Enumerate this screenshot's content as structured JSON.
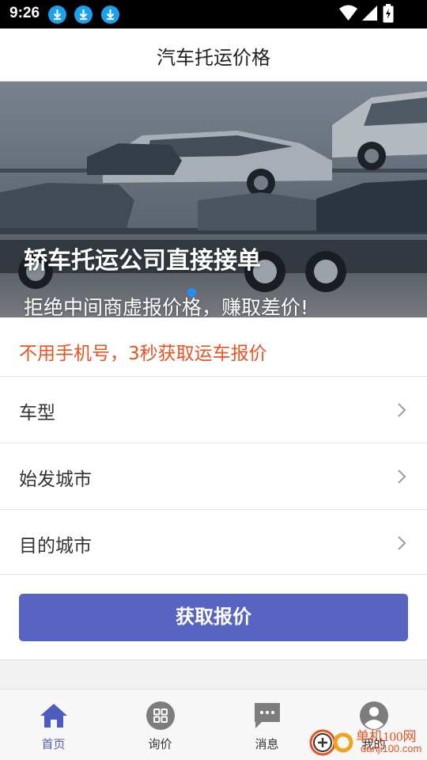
{
  "status_bar": {
    "time": "9:26",
    "notification_icons": [
      "download-icon",
      "download-icon",
      "download-icon"
    ],
    "system_icons": [
      "wifi-icon",
      "signal-icon",
      "battery-charging-icon"
    ]
  },
  "header": {
    "title": "汽车托运价格"
  },
  "banner": {
    "headline": "轿车托运公司直接接单",
    "subline": "拒绝中间商虚报价格，赚取差价!",
    "slide_count": 2,
    "active_slide": 1
  },
  "form": {
    "promo": "不用手机号，3秒获取运车报价",
    "fields": [
      {
        "label": "车型"
      },
      {
        "label": "始发城市"
      },
      {
        "label": "目的城市"
      }
    ],
    "submit_label": "获取报价"
  },
  "tabs": [
    {
      "label": "首页",
      "icon": "home-icon",
      "active": true
    },
    {
      "label": "询价",
      "icon": "grid-icon",
      "active": false
    },
    {
      "label": "消息",
      "icon": "message-icon",
      "active": false
    },
    {
      "label": "我的",
      "icon": "profile-icon",
      "active": false
    }
  ],
  "watermark": {
    "name": "单机100网",
    "url": "danji100.com"
  },
  "colors": {
    "accent": "#5764c1",
    "promo": "#f0511e",
    "active_tab": "#4d5cc1",
    "inactive_tab_icon": "#7d7d7d",
    "dot_active": "#1e90ff"
  }
}
